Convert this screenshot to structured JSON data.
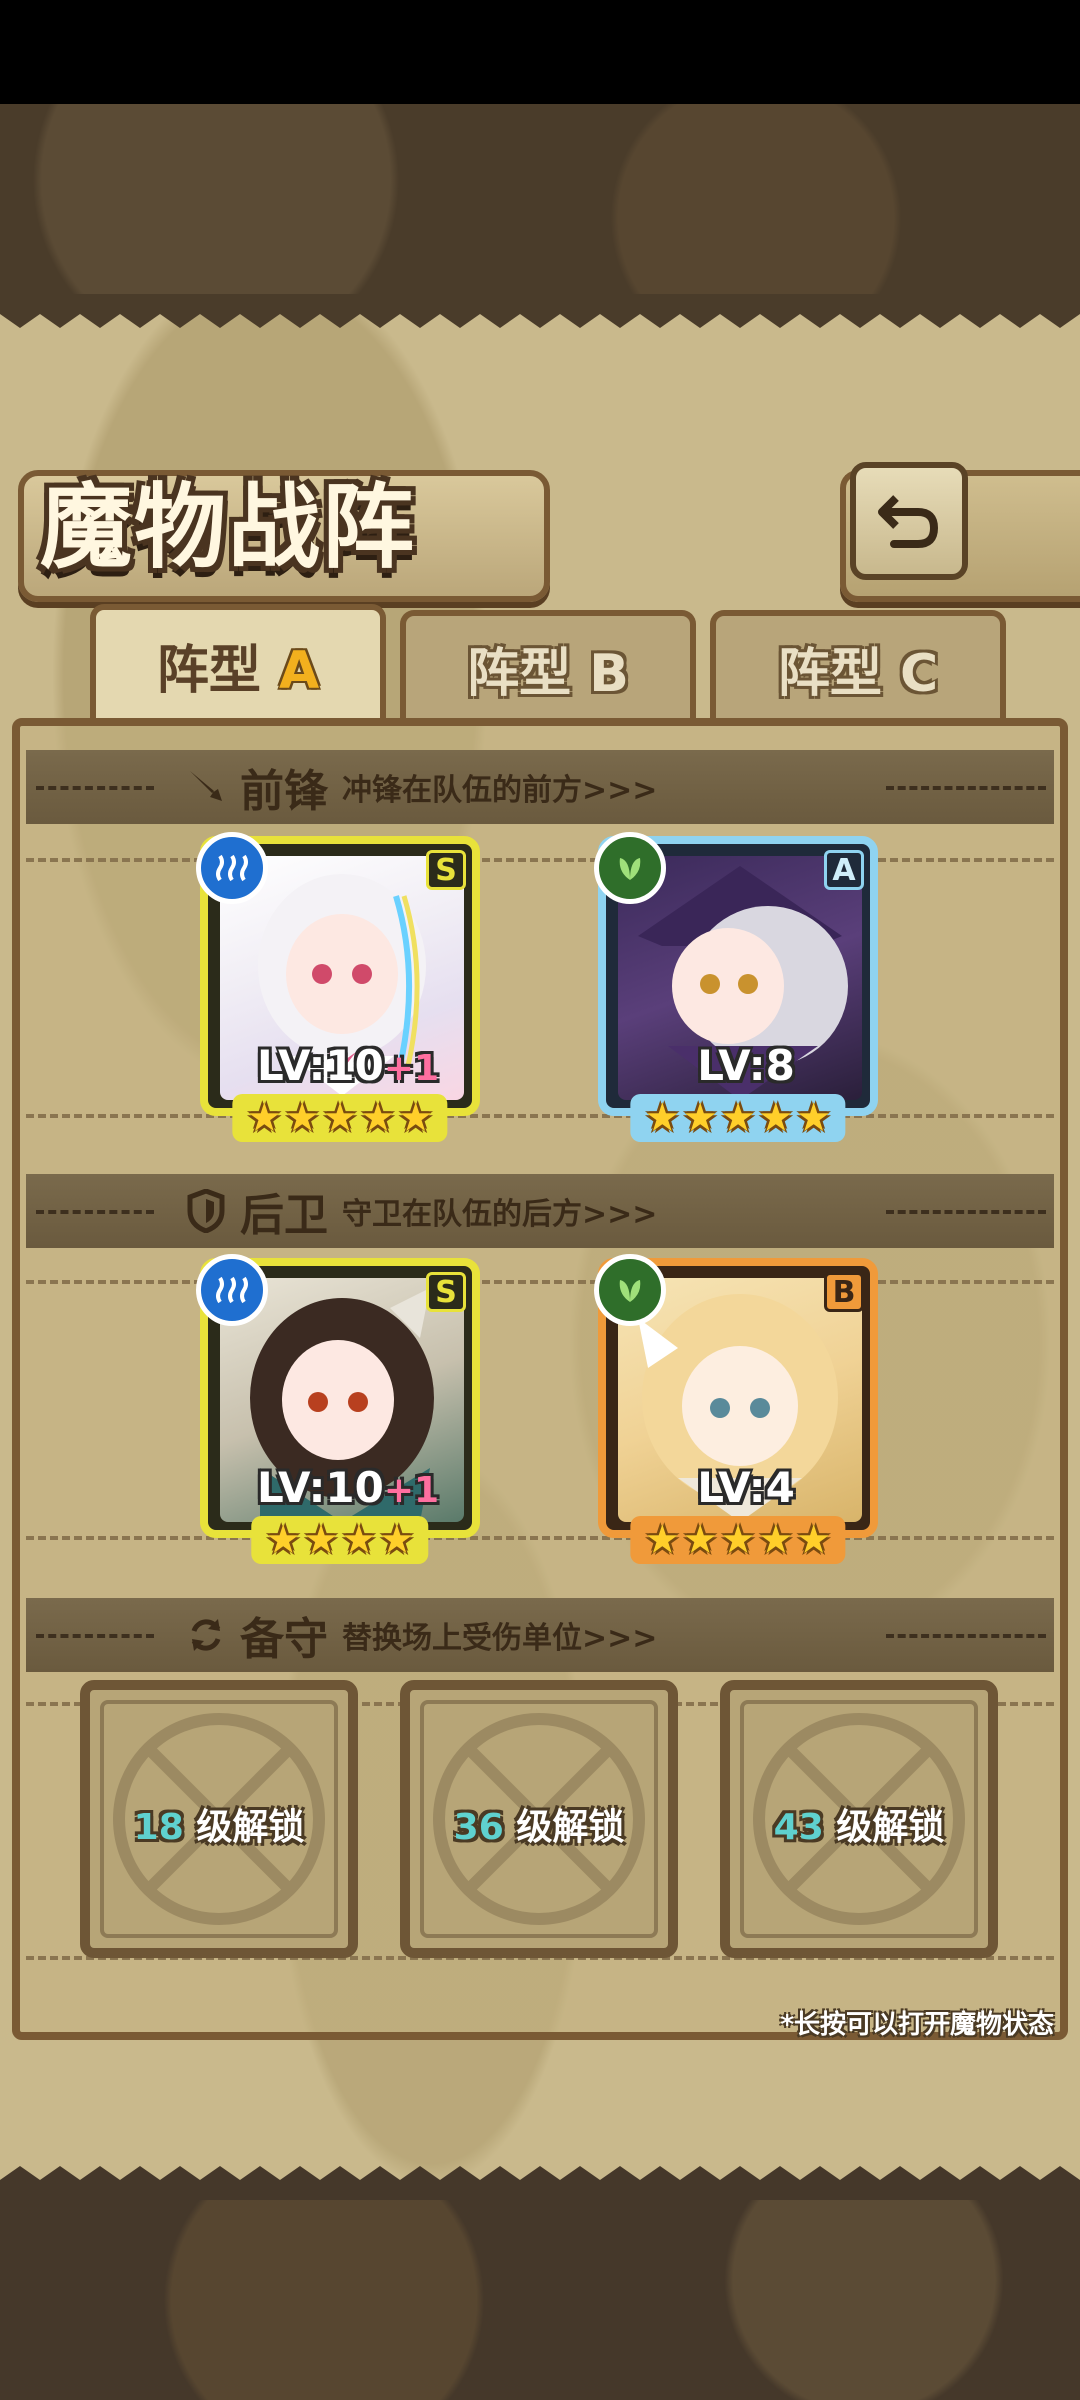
{
  "title": "魔物战阵",
  "back_icon": "undo-arrow-icon",
  "tabs": [
    {
      "prefix": "阵型",
      "letter": "A",
      "active": true
    },
    {
      "prefix": "阵型",
      "letter": "B",
      "active": false
    },
    {
      "prefix": "阵型",
      "letter": "C",
      "active": false
    }
  ],
  "vanguard": {
    "icon": "sword-icon",
    "title": "前锋",
    "subtitle": "冲锋在队伍的前方>>>"
  },
  "rearguard": {
    "icon": "shield-icon",
    "title": "后卫",
    "subtitle": "守卫在队伍的后方>>>"
  },
  "reserve": {
    "icon": "swap-icon",
    "title": "备守",
    "subtitle": "替换场上受伤单位>>>"
  },
  "front_units": [
    {
      "element": "water",
      "rank": "S",
      "level": "LV:10",
      "bonus": "+1",
      "stars": 5,
      "frame": "#e8e23a"
    },
    {
      "element": "nature",
      "rank": "A",
      "level": "LV:8",
      "bonus": "",
      "stars": 5,
      "frame": "#8fd3f0"
    }
  ],
  "back_units": [
    {
      "element": "water",
      "rank": "S",
      "level": "LV:10",
      "bonus": "+1",
      "stars": 4,
      "frame": "#e8e23a"
    },
    {
      "element": "nature",
      "rank": "B",
      "level": "LV:4",
      "bonus": "",
      "stars": 5,
      "frame": "#f09a3a"
    }
  ],
  "reserve_slots": [
    {
      "level": "18",
      "label": "级解锁"
    },
    {
      "level": "36",
      "label": "级解锁"
    },
    {
      "level": "43",
      "label": "级解锁"
    }
  ],
  "hint": "*长按可以打开魔物状态",
  "colors": {
    "accent": "#f2b01e",
    "parchment": "#c9b98c",
    "frame": "#7a5a34",
    "water": "#1f6fd0",
    "nature": "#2f6e2a"
  }
}
